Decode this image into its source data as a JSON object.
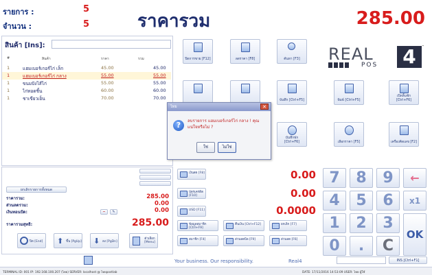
{
  "header": {
    "items_label": "รายการ :",
    "items_count": "5",
    "quantity_label": "จำนวน :",
    "quantity_count": "5",
    "title": "ราคารวม",
    "grand_total": "285.00"
  },
  "product_input": {
    "label": "สินค้า [Ins]:",
    "value": ""
  },
  "items_table": {
    "headers": [
      "#",
      "สินค้า",
      "ราคา",
      "รวม"
    ],
    "rows": [
      {
        "qty": "1",
        "name": "แฮมเบอร์เกอร์ไก่ เล็ก",
        "price": "45.00",
        "total": "45.00",
        "selected": false
      },
      {
        "qty": "1",
        "name": "แฮมเบอร์เกอร์ไก่ กลาง",
        "price": "55.00",
        "total": "55.00",
        "selected": true
      },
      {
        "qty": "1",
        "name": "ขนมปังไส้ไก่",
        "price": "55.00",
        "total": "55.00",
        "selected": false
      },
      {
        "qty": "1",
        "name": "ไก่ทอดชิ้น",
        "price": "60.00",
        "total": "60.00",
        "selected": false
      },
      {
        "qty": "1",
        "name": "ชาเขียวเย็น",
        "price": "70.00",
        "total": "70.00",
        "selected": false
      }
    ]
  },
  "summary": {
    "button_label": "ยกเลิกรายการทั้งหมด",
    "subtotal_label": "ราคารวม:",
    "subtotal": "285.00",
    "discount_label": "ส่วนลดรวม:",
    "discount": "0.00",
    "rounding_label": "เงินทอนปัด:",
    "rounding": "0.00",
    "net_label": "ราคารวมสุทธิ:",
    "net": "285.00"
  },
  "bottom_left_buttons": [
    {
      "label": "ปิด [End]",
      "icon": "power-icon"
    },
    {
      "label": "ขึ้น [PgUp]",
      "icon": "arrow-up-icon"
    },
    {
      "label": "ลง [PgDn]",
      "icon": "arrow-down-icon"
    },
    {
      "label": "ตัวเลือก [Menu]",
      "icon": "menu-icon"
    }
  ],
  "tiles": [
    {
      "label": "ปิดการขาย [F12]"
    },
    {
      "label": "ลดราคา [F8]"
    },
    {
      "label": "ค้นหา [F3]"
    },
    {
      "label": "พิมพ์ [Ctrl+F5]"
    },
    {
      "label": "เปิดลิ้นชัก [Ctrl+F6]"
    },
    {
      "label": "รายงาน [F4]"
    },
    {
      "label": "โอนย้าย [F6]"
    },
    {
      "label": "บันทึก [Ctrl+F5]"
    },
    {
      "label": "บันทึกพัก [Ctrl+F6]"
    },
    {
      "label": "เลือกราคา [F5]"
    },
    {
      "label": "เครื่องคิดเลข [F2]"
    }
  ],
  "payments": [
    {
      "label": "เงินสด [F8]",
      "amount": "0.00"
    },
    {
      "label": "บัตรเครดิต [F10]",
      "amount": "0.00"
    },
    {
      "label": "USD [F11]",
      "amount": "0.0000"
    }
  ],
  "bottom_tiles": [
    {
      "label": "ข้อมูลสมาชิก [Ctrl+F9]"
    },
    {
      "label": "คืนเงิน [Ctrl+F12]"
    },
    {
      "label": "ยกเลิก [F7]"
    },
    {
      "label": "สมาชิก [F4]"
    },
    {
      "label": "ส่วนลดบิล [F9]"
    },
    {
      "label": "ส่วนลด [F6]"
    }
  ],
  "keypad": {
    "keys": [
      "7",
      "8",
      "9",
      "←",
      "4",
      "5",
      "6",
      "x1",
      "1",
      "2",
      "3",
      "0",
      ".",
      "C"
    ],
    "ok": "OK"
  },
  "logo": {
    "text": "REAL",
    "sub": "POS",
    "num": "4",
    "tm": "™"
  },
  "footer": {
    "slogan": "Your business. Our responsibility.",
    "brand": "Real4",
    "ins_button": "INS [Ctrl+F1]",
    "status_left": "TERMINAL ID: 001    IP: 192.168.100.207 (ไทย)    SERVER: localhost @ ไทยpostlab",
    "status_right": "DATE: 17/11/2016 14:53:09   USER: ไทย ผู้ใช้"
  },
  "dialog": {
    "title": "ไทย",
    "message": "ลบรายการ แฮมเบอร์เกอร์ไก่ กลาง ! คุณแน่ใจหรือไม่ ?",
    "yes": "ใช่",
    "no": "ไม่ใช่"
  },
  "colors": {
    "accent_red": "#d81c1c",
    "navy": "#1f2e6e",
    "key_blue": "#7f95c6"
  }
}
